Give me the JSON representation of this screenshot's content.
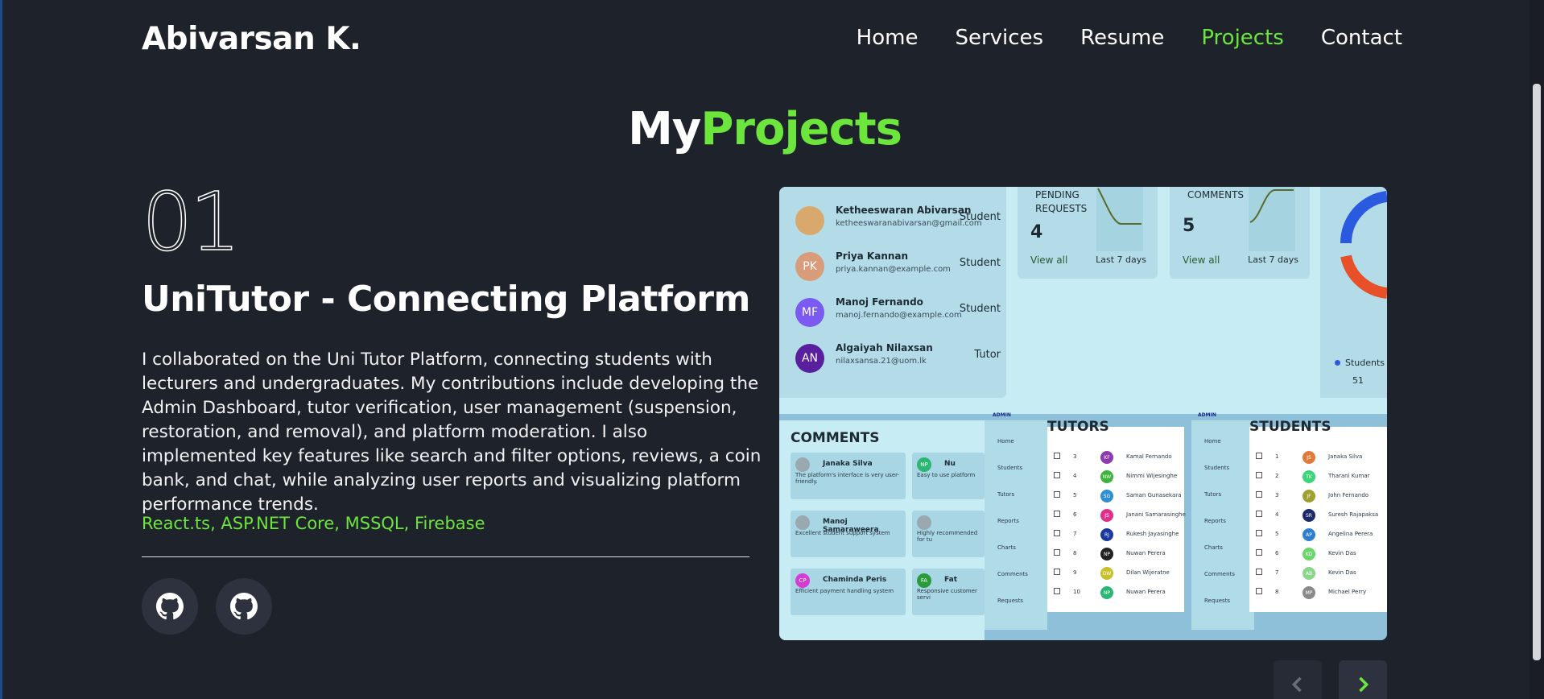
{
  "header": {
    "logo": "Abivarsan K.",
    "nav": [
      {
        "label": "Home",
        "active": false
      },
      {
        "label": "Services",
        "active": false
      },
      {
        "label": "Resume",
        "active": false
      },
      {
        "label": "Projects",
        "active": true
      },
      {
        "label": "Contact",
        "active": false
      }
    ]
  },
  "section": {
    "title_plain": "My",
    "title_accent": "Projects"
  },
  "project": {
    "number": "01",
    "title": "UniTutor - Connecting Platform",
    "description": "I collaborated on the Uni Tutor Platform, connecting students with lecturers and undergraduates. My contributions include developing the Admin Dashboard, tutor verification, user management (suspension, restoration, and removal), and platform moderation. I also implemented key features like search and filter options, reviews, a coin bank, and chat, while analyzing user reports and visualizing platform performance trends.",
    "tech": "React.ts, ASP.NET Core, MSSQL, Firebase",
    "links": [
      {
        "icon": "github-icon",
        "name": "github-live-button"
      },
      {
        "icon": "github-icon",
        "name": "github-repo-button"
      }
    ]
  },
  "preview": {
    "users": [
      {
        "name": "Ketheeswaran Abivarsan",
        "email": "ketheeswaranabivarsan@gmail.com",
        "role": "Student",
        "initials": "",
        "color": "#d9a86c"
      },
      {
        "name": "Priya Kannan",
        "email": "priya.kannan@example.com",
        "role": "Student",
        "initials": "PK",
        "color": "#d99c7a"
      },
      {
        "name": "Manoj Fernando",
        "email": "manoj.fernando@example.com",
        "role": "Student",
        "initials": "MF",
        "color": "#7a5af0"
      },
      {
        "name": "Algaiyah Nilaxsan",
        "email": "nilaxsansa.21@uom.lk",
        "role": "Tutor",
        "initials": "AN",
        "color": "#5a1f9e"
      }
    ],
    "stats": [
      {
        "label": "PENDING\nREQUESTS",
        "value": "4",
        "link": "View all",
        "period": "Last 7 days"
      },
      {
        "label": "COMMENTS",
        "value": "5",
        "link": "View all",
        "period": "Last 7 days"
      }
    ],
    "donut": {
      "legend": "Students",
      "value": "51"
    },
    "panels": {
      "comments_title": "COMMENTS",
      "tutors_title": "TUTORS",
      "students_title": "STUDENTS",
      "admin_label": "ADMIN"
    },
    "comment_cards": [
      {
        "name": "Janaka Silva",
        "text": "The platform's interface is very user-friendly.",
        "initials": "",
        "color": "#9aa8b0"
      },
      {
        "name": "Nu",
        "text": "Easy to use platform",
        "initials": "NP",
        "color": "#2bb673"
      },
      {
        "name": "Manoj Samaraweera",
        "text": "Excellent student support system",
        "initials": "",
        "color": "#9aa8b0"
      },
      {
        "name": "",
        "text": "Highly recommended for tu",
        "initials": "",
        "color": "#9aa8b0"
      },
      {
        "name": "Chaminda Peris",
        "text": "Efficient payment handling system",
        "initials": "CP",
        "color": "#d63bd6"
      },
      {
        "name": "Fat",
        "text": "Responsive customer servi",
        "initials": "FA",
        "color": "#2a9a3a"
      }
    ],
    "side_nav_items": [
      "Home",
      "Students",
      "Tutors",
      "Reports",
      "Charts",
      "Comments",
      "Requests"
    ],
    "tutor_rows": [
      {
        "id": "3",
        "initials": "KF",
        "color": "#8e3bb0",
        "name": "Kamal Fernando"
      },
      {
        "id": "4",
        "initials": "NW",
        "color": "#3cb43c",
        "name": "Nimmi Wijesinghe"
      },
      {
        "id": "5",
        "initials": "SG",
        "color": "#2f8fd1",
        "name": "Saman Gunasekara"
      },
      {
        "id": "6",
        "initials": "JS",
        "color": "#e0308c",
        "name": "Janani Samarasinghe"
      },
      {
        "id": "7",
        "initials": "RJ",
        "color": "#1a3aa0",
        "name": "Rukesh Jayasinghe"
      },
      {
        "id": "8",
        "initials": "NP",
        "color": "#222222",
        "name": "Nuwan Perera"
      },
      {
        "id": "9",
        "initials": "DW",
        "color": "#c8c02a",
        "name": "Dilan Wijeratne"
      },
      {
        "id": "10",
        "initials": "NP",
        "color": "#2bb673",
        "name": "Nuwan Perera"
      }
    ],
    "student_rows": [
      {
        "id": "1",
        "initials": "JS",
        "color": "#e07a3a",
        "name": "Janaka Silva"
      },
      {
        "id": "2",
        "initials": "TK",
        "color": "#3cd67a",
        "name": "Tharani Kumar"
      },
      {
        "id": "3",
        "initials": "JF",
        "color": "#a0a030",
        "name": "John Fernando"
      },
      {
        "id": "4",
        "initials": "SR",
        "color": "#1a2a6a",
        "name": "Suresh Rajapaksa"
      },
      {
        "id": "5",
        "initials": "AP",
        "color": "#2f7fd1",
        "name": "Angelina Perera"
      },
      {
        "id": "6",
        "initials": "KD",
        "color": "#6ad66a",
        "name": "Kevin Das"
      },
      {
        "id": "7",
        "initials": "AB",
        "color": "#8ad68a",
        "name": "Kevin Das"
      },
      {
        "id": "8",
        "initials": "MP",
        "color": "#8a8a8a",
        "name": "Michael Perry"
      }
    ]
  },
  "controls": {
    "prev_icon": "chevron-left-icon",
    "next_icon": "chevron-right-icon"
  },
  "colors": {
    "background": "#1e222b",
    "accent": "#6ce53c",
    "button": "#2d323e"
  }
}
